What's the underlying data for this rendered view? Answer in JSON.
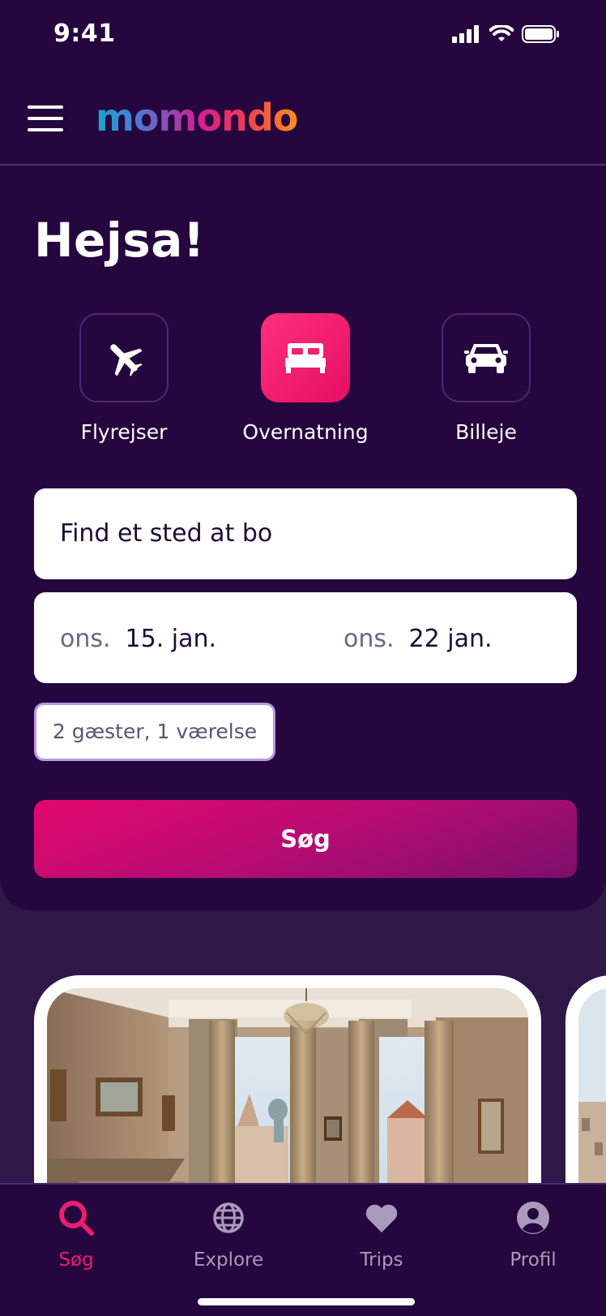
{
  "status_bar": {
    "time": "9:41"
  },
  "header": {
    "logo": "momondo"
  },
  "greeting": "Hejsa!",
  "categories": [
    {
      "label": "Flyrejser",
      "icon": "plane-icon",
      "active": false
    },
    {
      "label": "Overnatning",
      "icon": "bed-icon",
      "active": true
    },
    {
      "label": "Billeje",
      "icon": "car-icon",
      "active": false
    }
  ],
  "search": {
    "destination_placeholder": "Find et sted at bo",
    "checkin_day": "ons.",
    "checkin_date": "15. jan.",
    "checkout_day": "ons.",
    "checkout_date": "22 jan.",
    "guests": "2 gæster, 1 værelse",
    "button_label": "Søg"
  },
  "bottom_nav": [
    {
      "label": "Søg",
      "icon": "search-icon",
      "active": true
    },
    {
      "label": "Explore",
      "icon": "globe-icon",
      "active": false
    },
    {
      "label": "Trips",
      "icon": "heart-icon",
      "active": false
    },
    {
      "label": "Profil",
      "icon": "profile-icon",
      "active": false
    }
  ],
  "colors": {
    "background": "#26063e",
    "accent": "#e91e6f",
    "button_gradient_start": "#e2086c",
    "button_gradient_end": "#7b0f6b",
    "nav_inactive": "#a99abb"
  }
}
